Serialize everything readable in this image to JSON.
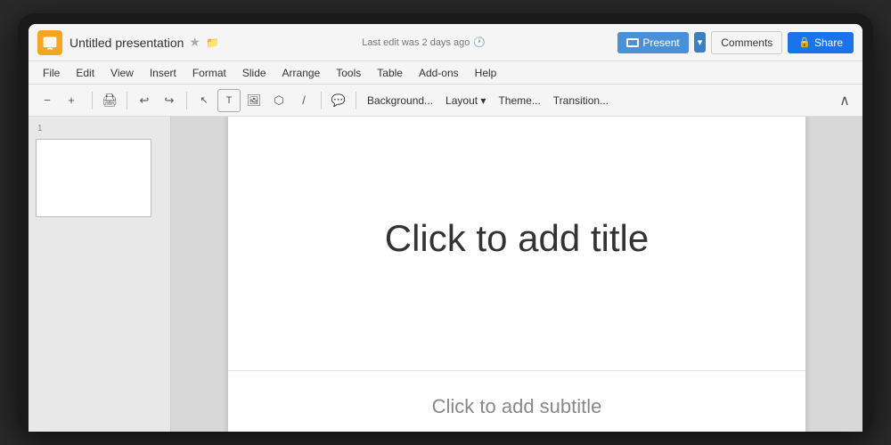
{
  "app": {
    "icon_label": "slides-icon",
    "title": "Untitled presentation",
    "star_icon": "★",
    "folder_icon": "📁",
    "last_edit": "Last edit was 2 days ago",
    "clock_icon": "🕐"
  },
  "menu": {
    "items": [
      "File",
      "Edit",
      "View",
      "Insert",
      "Format",
      "Slide",
      "Arrange",
      "Tools",
      "Table",
      "Add-ons",
      "Help"
    ]
  },
  "toolbar": {
    "zoom_out": "−",
    "zoom_in": "+",
    "print": "🖨",
    "undo": "↩",
    "redo": "↪",
    "cursor": "↗",
    "text_box": "T",
    "image": "🖼",
    "shape": "⬡",
    "line": "╱",
    "background_btn": "Background...",
    "layout_btn": "Layout ▾",
    "theme_btn": "Theme...",
    "transition_btn": "Transition...",
    "collapse": "∧"
  },
  "header_buttons": {
    "present": "Present",
    "present_arrow": "▾",
    "comments": "Comments",
    "share": "Share"
  },
  "slide_panel": {
    "slide_number": "1"
  },
  "canvas": {
    "title_placeholder": "Click to add title",
    "subtitle_placeholder": "Click to add subtitle"
  }
}
